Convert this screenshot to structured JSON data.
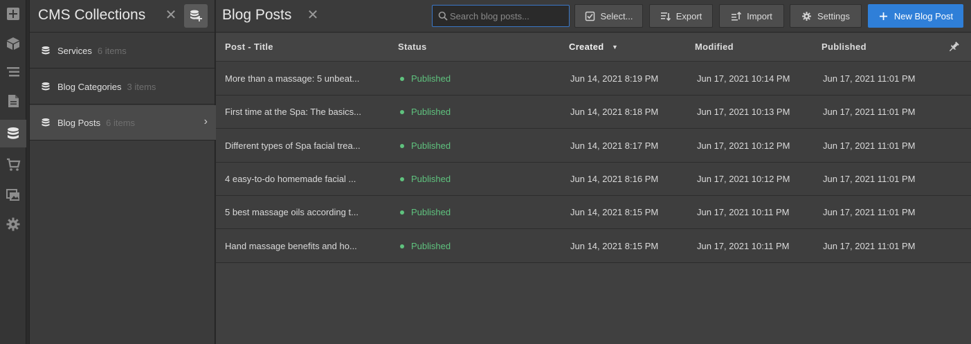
{
  "colors": {
    "accent": "#2f7fd8",
    "status_published": "#5fc27e",
    "search_border": "#3a78c7"
  },
  "rail": {
    "items": [
      {
        "icon": "add-icon"
      },
      {
        "icon": "box-icon"
      },
      {
        "icon": "navigator-icon"
      },
      {
        "icon": "pages-icon"
      },
      {
        "icon": "database-icon",
        "active": true
      },
      {
        "icon": "cart-icon"
      },
      {
        "icon": "assets-icon"
      },
      {
        "icon": "gear-icon"
      }
    ]
  },
  "collections": {
    "title": "CMS Collections",
    "close_icon": "close-icon",
    "add_icon": "add-collection-icon",
    "items": [
      {
        "name": "Services",
        "count": "6 items",
        "active": false
      },
      {
        "name": "Blog Categories",
        "count": "3 items",
        "active": false
      },
      {
        "name": "Blog Posts",
        "count": "6 items",
        "active": true
      }
    ]
  },
  "main": {
    "title": "Blog Posts",
    "search": {
      "placeholder": "Search blog posts...",
      "value": ""
    },
    "buttons": {
      "select": "Select...",
      "export": "Export",
      "import": "Import",
      "settings": "Settings",
      "new_post": "New Blog Post"
    },
    "columns": {
      "title": "Post - Title",
      "status": "Status",
      "created": "Created",
      "modified": "Modified",
      "published": "Published"
    },
    "sort": {
      "column": "Created",
      "direction": "descending"
    },
    "rows": [
      {
        "title": "More than a massage: 5 unbeat...",
        "status": "Published",
        "created": "Jun 14, 2021 8:19 PM",
        "modified": "Jun 17, 2021 10:14 PM",
        "published": "Jun 17, 2021 11:01 PM"
      },
      {
        "title": "First time at the Spa: The basics...",
        "status": "Published",
        "created": "Jun 14, 2021 8:18 PM",
        "modified": "Jun 17, 2021 10:13 PM",
        "published": "Jun 17, 2021 11:01 PM"
      },
      {
        "title": "Different types of Spa facial trea...",
        "status": "Published",
        "created": "Jun 14, 2021 8:17 PM",
        "modified": "Jun 17, 2021 10:12 PM",
        "published": "Jun 17, 2021 11:01 PM"
      },
      {
        "title": "4 easy-to-do homemade facial ...",
        "status": "Published",
        "created": "Jun 14, 2021 8:16 PM",
        "modified": "Jun 17, 2021 10:12 PM",
        "published": "Jun 17, 2021 11:01 PM"
      },
      {
        "title": "5 best massage oils according t...",
        "status": "Published",
        "created": "Jun 14, 2021 8:15 PM",
        "modified": "Jun 17, 2021 10:11 PM",
        "published": "Jun 17, 2021 11:01 PM"
      },
      {
        "title": "Hand massage benefits and ho...",
        "status": "Published",
        "created": "Jun 14, 2021 8:15 PM",
        "modified": "Jun 17, 2021 10:11 PM",
        "published": "Jun 17, 2021 11:01 PM"
      }
    ]
  }
}
